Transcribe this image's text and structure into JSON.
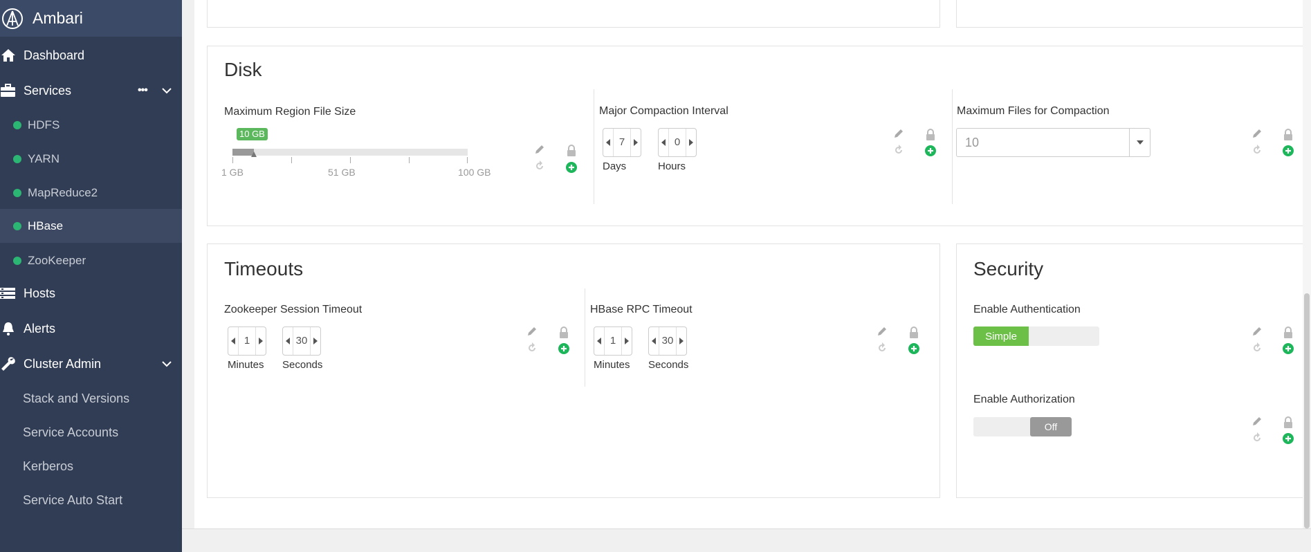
{
  "app": {
    "title": "Ambari"
  },
  "sidebar": {
    "dashboard": "Dashboard",
    "services": "Services",
    "services_more": "•••",
    "service_items": [
      {
        "label": "HDFS",
        "status": "green"
      },
      {
        "label": "YARN",
        "status": "green"
      },
      {
        "label": "MapReduce2",
        "status": "green"
      },
      {
        "label": "HBase",
        "status": "green",
        "active": true
      },
      {
        "label": "ZooKeeper",
        "status": "green"
      }
    ],
    "hosts": "Hosts",
    "alerts": "Alerts",
    "cluster_admin": "Cluster Admin",
    "admin_items": [
      "Stack and Versions",
      "Service Accounts",
      "Kerberos",
      "Service Auto Start"
    ]
  },
  "disk": {
    "title": "Disk",
    "max_region": {
      "label": "Maximum Region File Size",
      "value": "10 GB",
      "value_fraction": 0.09,
      "ticks": [
        "1 GB",
        "51 GB",
        "100 GB"
      ]
    },
    "major_compaction": {
      "label": "Major Compaction Interval",
      "days": "7",
      "days_label": "Days",
      "hours": "0",
      "hours_label": "Hours"
    },
    "max_files": {
      "label": "Maximum Files for Compaction",
      "value": "10"
    }
  },
  "timeouts": {
    "title": "Timeouts",
    "zookeeper": {
      "label": "Zookeeper Session Timeout",
      "minutes": "1",
      "minutes_label": "Minutes",
      "seconds": "30",
      "seconds_label": "Seconds"
    },
    "rpc": {
      "label": "HBase RPC Timeout",
      "minutes": "1",
      "minutes_label": "Minutes",
      "seconds": "30",
      "seconds_label": "Seconds"
    }
  },
  "security": {
    "title": "Security",
    "authentication": {
      "label": "Enable Authentication",
      "value": "Simple"
    },
    "authorization": {
      "label": "Enable Authorization",
      "value": "Off"
    }
  },
  "colors": {
    "sidebar": "#313d54",
    "brand": "#3b4a66",
    "status_green": "#2bb673",
    "toggle_green": "#6cbf47",
    "add_green": "#1eb65a"
  }
}
